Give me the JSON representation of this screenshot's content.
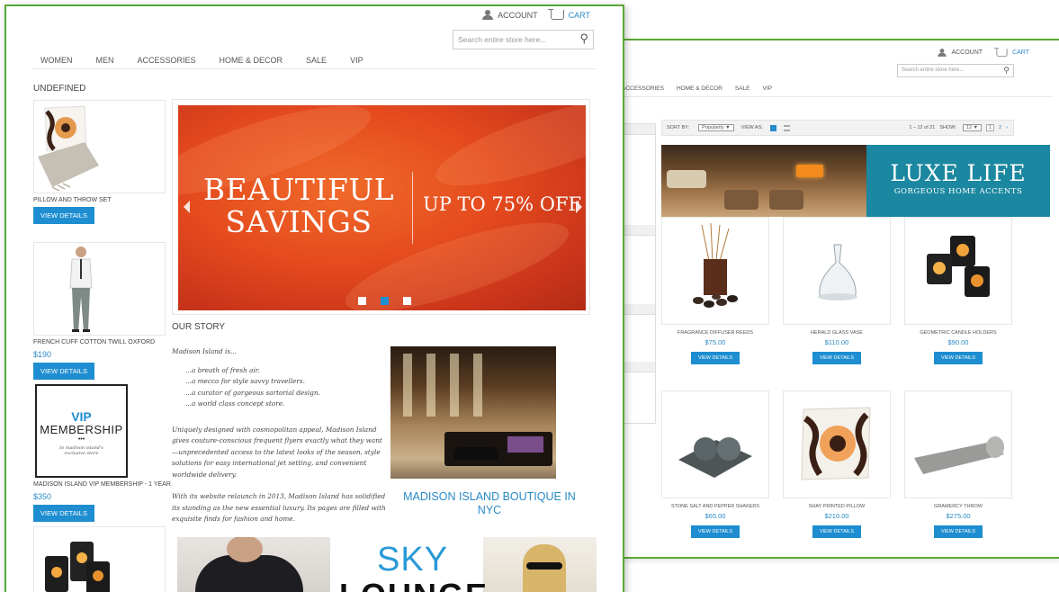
{
  "colors": {
    "accent": "#1e8ed1",
    "link": "#2a8ac6",
    "frame": "#5aa832",
    "banner_red": "#e44a1e",
    "banner_teal": "#1b87a0"
  },
  "front": {
    "header": {
      "account_label": "ACCOUNT",
      "cart_label": "CART",
      "account_icon": "user-icon",
      "cart_icon": "cart-icon"
    },
    "search": {
      "placeholder": "Search entire store here...",
      "icon": "search-icon"
    },
    "nav": [
      "WOMEN",
      "MEN",
      "ACCESSORIES",
      "HOME & DECOR",
      "SALE",
      "VIP"
    ],
    "sidebar": {
      "title": "UNDEFINED",
      "products": [
        {
          "name": "PILLOW AND THROW SET",
          "price": "",
          "button": "VIEW DETAILS"
        },
        {
          "name": "FRENCH CUFF COTTON TWILL OXFORD",
          "price": "$190",
          "button": "VIEW DETAILS"
        },
        {
          "name": "MADISON ISLAND VIP MEMBERSHIP - 1 YEAR",
          "price": "$350",
          "button": "VIEW DETAILS",
          "badge_title": "VIP",
          "badge_sub": "MEMBERSHIP",
          "badge_dots": "•••",
          "badge_note": "to madison island's exclusive store"
        }
      ]
    },
    "slider": {
      "headline": "BEAUTIFUL SAVINGS",
      "offer": "UP TO 75% OFF",
      "active_slide": 2,
      "slide_count": 3
    },
    "story": {
      "title": "OUR STORY",
      "intro": "Madison Island is...",
      "lines": [
        "...a breath of fresh air.",
        "...a mecca for style savvy travellers.",
        "...a curator of gorgeous sartorial design.",
        "...a world class concept store."
      ],
      "para1": "Uniquely designed with cosmopolitan appeal, Madison Island gives couture-conscious frequent flyers exactly what they want—unprecedented access to the latest looks of the season, style solutions for easy international jet setting, and convenient worldwide delivery.",
      "para2": "With its website relaunch in 2013, Madison Island has solidified its standing as the new essential luxury. Its pages are filled with exquisite finds for fashion and home."
    },
    "boutique_caption": "MADISON ISLAND BOUTIQUE IN NYC",
    "sky": {
      "word1": "SKY",
      "word2": "LOUNGE"
    }
  },
  "back": {
    "header": {
      "account_label": "ACCOUNT",
      "cart_label": "CART"
    },
    "search": {
      "placeholder": "Search entire store here..."
    },
    "nav": [
      "ACCESSORIES",
      "HOME & DECOR",
      "SALE",
      "VIP"
    ],
    "toolbar": {
      "sort_label": "SORT BY:",
      "sort_value": "Popularity",
      "view_label": "VIEW AS:",
      "count_text": "1 – 12 of 21",
      "show_label": "SHOW:",
      "show_value": "12",
      "page_current": "1",
      "page_next": "2",
      "next_arrow": "›"
    },
    "banner": {
      "title": "LUXE LIFE",
      "subtitle": "GORGEOUS HOME ACCENTS"
    },
    "products": [
      {
        "name": "FRAGRANCE DIFFUSER REEDS",
        "price": "$75.00",
        "button": "VIEW DETAILS"
      },
      {
        "name": "HERALD GLASS VASE",
        "price": "$110.00",
        "button": "VIEW DETAILS"
      },
      {
        "name": "GEOMETRIC CANDLE HOLDERS",
        "price": "$90.00",
        "button": "VIEW DETAILS"
      },
      {
        "name": "STONE SALT AND PEPPER SHAKERS",
        "price": "$65.00",
        "button": "VIEW DETAILS"
      },
      {
        "name": "SHAY PRINTED PILLOW",
        "price": "$210.00",
        "button": "VIEW DETAILS"
      },
      {
        "name": "GRAMERCY THROW",
        "price": "$275.00",
        "button": "VIEW DETAILS"
      }
    ]
  }
}
